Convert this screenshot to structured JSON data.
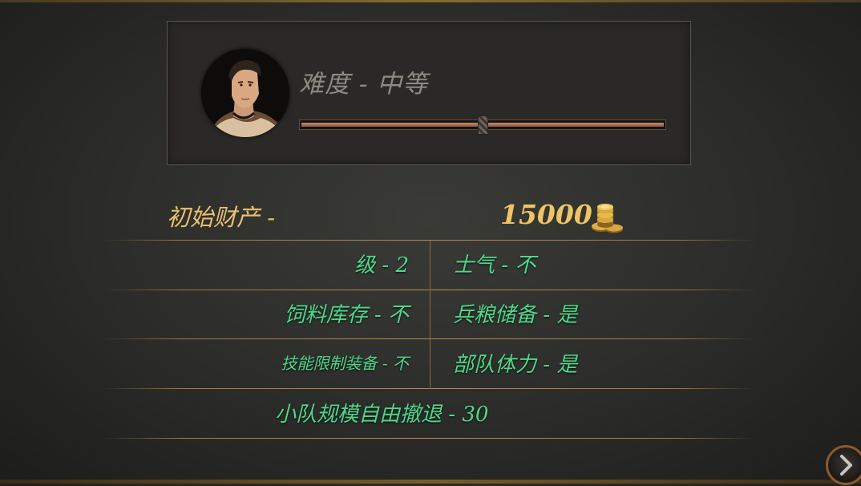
{
  "difficulty": {
    "label": "难度 - 中等",
    "slider_level_fraction": 0.5
  },
  "wealth": {
    "label": "初始财产 -",
    "value": "15000",
    "icon": "gold-coins-icon"
  },
  "settings": {
    "level": "级 - 2",
    "morale": "士气 - 不",
    "fodder": "饲料库存 - 不",
    "rations": "兵粮储备 - 是",
    "skill_equipment": "技能限制装备 - 不",
    "stamina": "部队体力 - 是",
    "squad": "小队规模自由撤退 - 30"
  },
  "colors": {
    "accent_gold": "#f0c466",
    "setting_green": "#4fd88a",
    "label_gray": "#8e8a84"
  },
  "next_button": {
    "icon": "chevron-right-icon"
  }
}
